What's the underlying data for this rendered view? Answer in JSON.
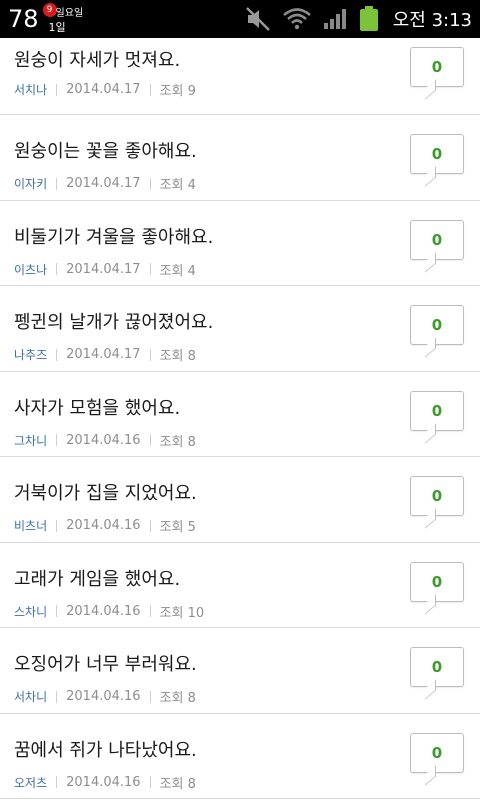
{
  "status_bar": {
    "battery_percent": "78",
    "calendar_badge": "9",
    "calendar_day_top": "일요일",
    "calendar_day_bottom": "1일",
    "time": "오전 3:13",
    "icons": [
      "mute-icon",
      "wifi-icon",
      "signal-icon",
      "battery-icon"
    ]
  },
  "posts": [
    {
      "title": "원숭이 자세가 멋져요.",
      "author": "서치나",
      "date": "2014.04.17",
      "views": "조회 9",
      "comments": "0"
    },
    {
      "title": "원숭이는 꽃을 좋아해요.",
      "author": "이자키",
      "date": "2014.04.17",
      "views": "조회 4",
      "comments": "0"
    },
    {
      "title": "비둘기가 겨울을 좋아해요.",
      "author": "이츠나",
      "date": "2014.04.17",
      "views": "조회 4",
      "comments": "0"
    },
    {
      "title": "펭귄의 날개가 끊어졌어요.",
      "author": "나추즈",
      "date": "2014.04.17",
      "views": "조회 8",
      "comments": "0"
    },
    {
      "title": "사자가 모험을 했어요.",
      "author": "그차니",
      "date": "2014.04.16",
      "views": "조회 8",
      "comments": "0"
    },
    {
      "title": "거북이가 집을 지었어요.",
      "author": "비츠너",
      "date": "2014.04.16",
      "views": "조회 5",
      "comments": "0"
    },
    {
      "title": "고래가 게임을 했어요.",
      "author": "스차니",
      "date": "2014.04.16",
      "views": "조회 10",
      "comments": "0"
    },
    {
      "title": "오징어가 너무 부러워요.",
      "author": "서차니",
      "date": "2014.04.16",
      "views": "조회 8",
      "comments": "0"
    },
    {
      "title": "꿈에서 쥐가 나타났어요.",
      "author": "오저츠",
      "date": "2014.04.16",
      "views": "조회 8",
      "comments": "0"
    }
  ],
  "colors": {
    "author": "#3d6fa8",
    "comment_count": "#3a9c29",
    "divider": "#d9d9d9",
    "status_bar_bg": "#000000",
    "battery": "#7cc23a"
  }
}
